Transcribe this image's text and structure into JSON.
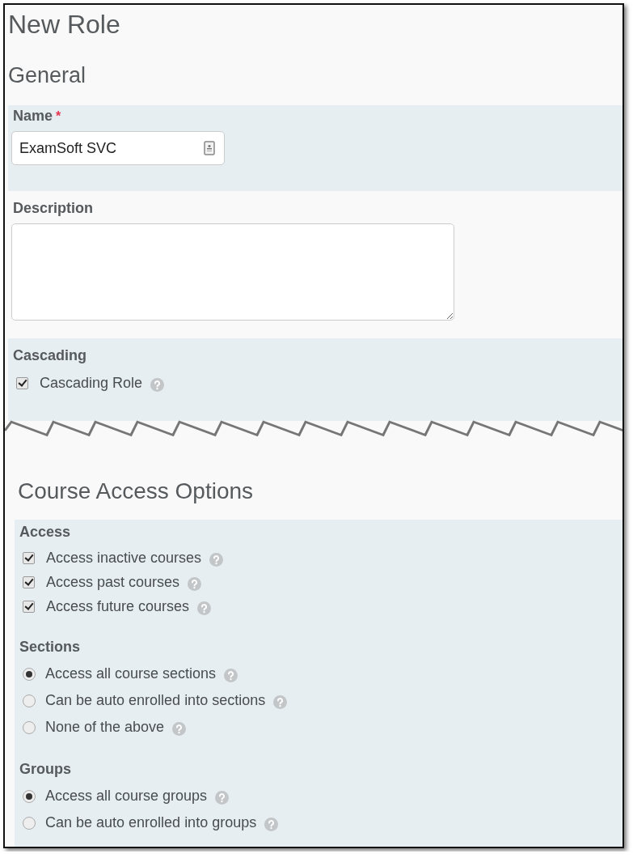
{
  "title": "New Role",
  "parts": [
    {
      "heading": "General",
      "fields": [
        {
          "kind": "text",
          "label": "Name",
          "required": true,
          "required_mark": "*",
          "value": "ExamSoft SVC"
        },
        {
          "kind": "textarea",
          "label": "Description"
        },
        {
          "kind": "checkboxes",
          "label": "Cascading",
          "options": [
            {
              "label": "Cascading Role",
              "checked": true,
              "help": true
            }
          ]
        }
      ]
    },
    {
      "heading": "Course Access Options",
      "fields": [
        {
          "kind": "checkboxes",
          "label": "Access",
          "options": [
            {
              "label": "Access inactive courses",
              "checked": true,
              "help": true
            },
            {
              "label": "Access past courses",
              "checked": true,
              "help": true
            },
            {
              "label": "Access future courses",
              "checked": true,
              "help": true
            }
          ]
        },
        {
          "kind": "radios",
          "label": "Sections",
          "options": [
            {
              "label": "Access all course sections",
              "selected": true,
              "help": true
            },
            {
              "label": "Can be auto enrolled into sections",
              "selected": false,
              "help": true
            },
            {
              "label": "None of the above",
              "selected": false,
              "help": true
            }
          ]
        },
        {
          "kind": "radios",
          "label": "Groups",
          "options": [
            {
              "label": "Access all course groups",
              "selected": true,
              "help": true
            },
            {
              "label": "Can be auto enrolled into groups",
              "selected": false,
              "help": true
            }
          ]
        }
      ]
    }
  ]
}
